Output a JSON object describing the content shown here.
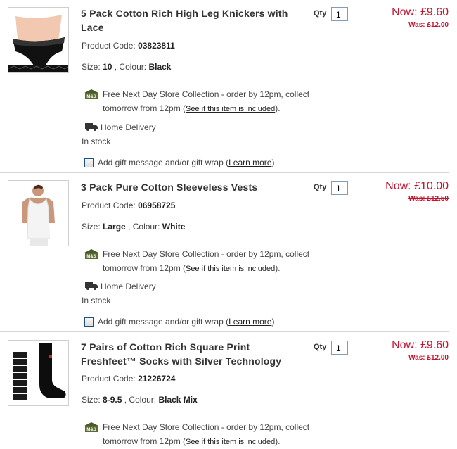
{
  "items": [
    {
      "title_line1": "5 Pack Cotton Rich High Leg Knickers with",
      "title_line2": "Lace",
      "product_code_label": "Product Code:",
      "product_code": "03823811",
      "size_label": "Size:",
      "size": "10",
      "colour_label": ", Colour:",
      "colour": "Black",
      "qty_label": "Qty",
      "qty_value": "1",
      "now_price": "Now: £9.60",
      "was_price": "Was: £12.00",
      "store_text_1": "Free Next Day Store Collection - order by 12pm, collect",
      "store_text_2": "tomorrow from 12pm (",
      "store_link": "See if this item is included",
      "store_text_3": ").",
      "home_delivery": "Home Delivery",
      "stock": "In stock",
      "gift_text": "Add gift message and/or gift wrap (",
      "gift_link": "Learn more",
      "gift_end": ")"
    },
    {
      "title_line1": "3 Pack Pure Cotton Sleeveless Vests",
      "title_line2": "",
      "product_code_label": "Product Code:",
      "product_code": "06958725",
      "size_label": "Size:",
      "size": "Large",
      "colour_label": " , Colour:",
      "colour": "White",
      "qty_label": "Qty",
      "qty_value": "1",
      "now_price": "Now: £10.00",
      "was_price": "Was: £12.50",
      "store_text_1": "Free Next Day Store Collection - order by 12pm, collect",
      "store_text_2": "tomorrow from 12pm (",
      "store_link": "See if this item is included",
      "store_text_3": ").",
      "home_delivery": "Home Delivery",
      "stock": "In stock",
      "gift_text": "Add gift message and/or gift wrap (",
      "gift_link": "Learn more",
      "gift_end": ")"
    },
    {
      "title_line1": "7 Pairs of Cotton Rich Square Print",
      "title_line2": "Freshfeet™ Socks with Silver Technology",
      "product_code_label": "Product Code:",
      "product_code": "21226724",
      "size_label": "Size:",
      "size": "8-9.5",
      "colour_label": " , Colour:",
      "colour": "Black Mix",
      "qty_label": "Qty",
      "qty_value": "1",
      "now_price": "Now: £9.60",
      "was_price": "Was: £12.00",
      "store_text_1": "Free Next Day Store Collection - order by 12pm, collect",
      "store_text_2": "tomorrow from 12pm (",
      "store_link": "See if this item is included",
      "store_text_3": ")."
    }
  ],
  "icons": {
    "store": "store-collection-icon",
    "van": "delivery-van-icon"
  },
  "colors": {
    "price": "#c8102e",
    "divider": "#d6d6d6",
    "text": "#333333"
  }
}
